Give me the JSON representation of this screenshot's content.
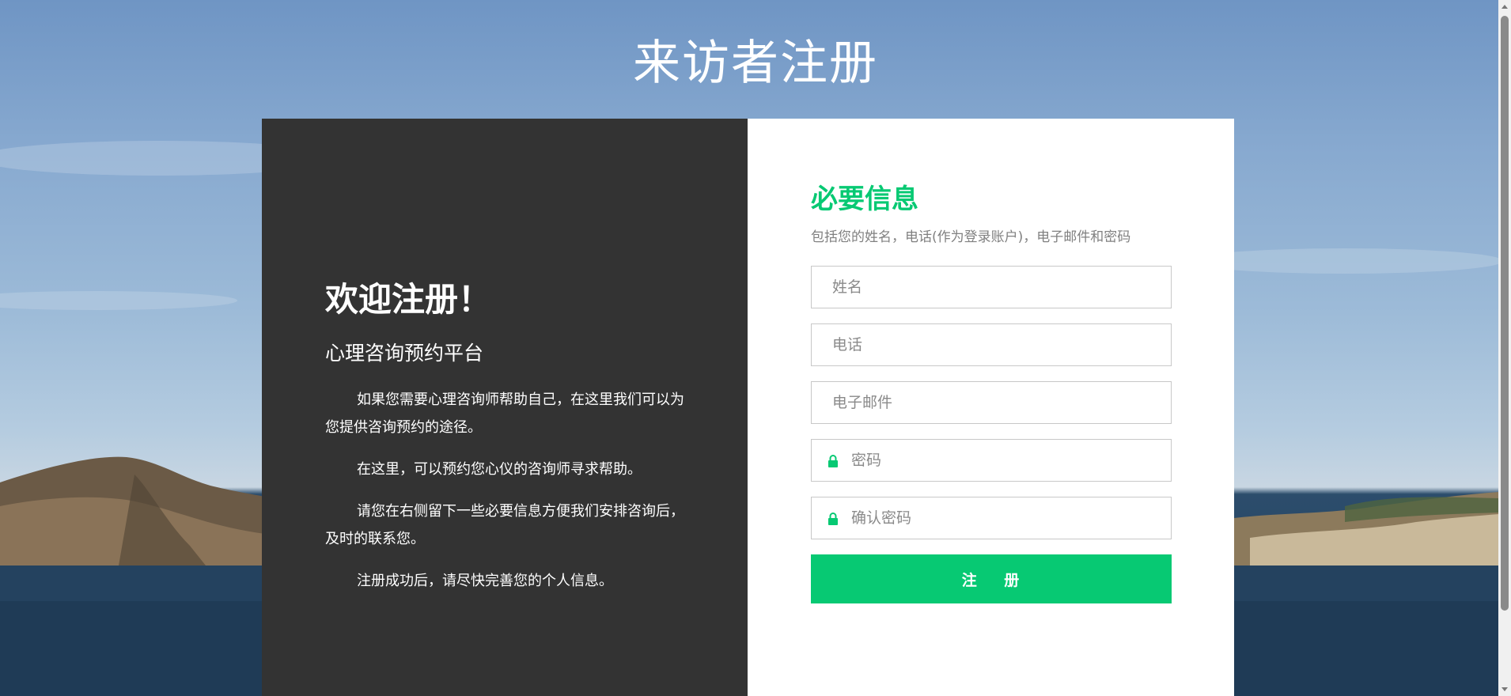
{
  "page": {
    "title": "来访者注册"
  },
  "left_panel": {
    "welcome": "欢迎注册！",
    "subtitle": "心理咨询预约平台",
    "paragraphs": [
      "如果您需要心理咨询师帮助自己，在这里我们可以为您提供咨询预约的途径。",
      "在这里，可以预约您心仪的咨询师寻求帮助。",
      "请您在右侧留下一些必要信息方便我们安排咨询后，及时的联系您。",
      "注册成功后，请尽快完善您的个人信息。"
    ]
  },
  "form": {
    "title": "必要信息",
    "description": "包括您的姓名，电话(作为登录账户)，电子邮件和密码",
    "name_placeholder": "姓名",
    "phone_placeholder": "电话",
    "email_placeholder": "电子邮件",
    "password_placeholder": "密码",
    "confirm_password_placeholder": "确认密码",
    "submit_label": "注 册",
    "lock_icon": "lock-icon"
  },
  "colors": {
    "accent": "#07c973",
    "panel_dark": "#333333",
    "panel_light": "#ffffff"
  }
}
